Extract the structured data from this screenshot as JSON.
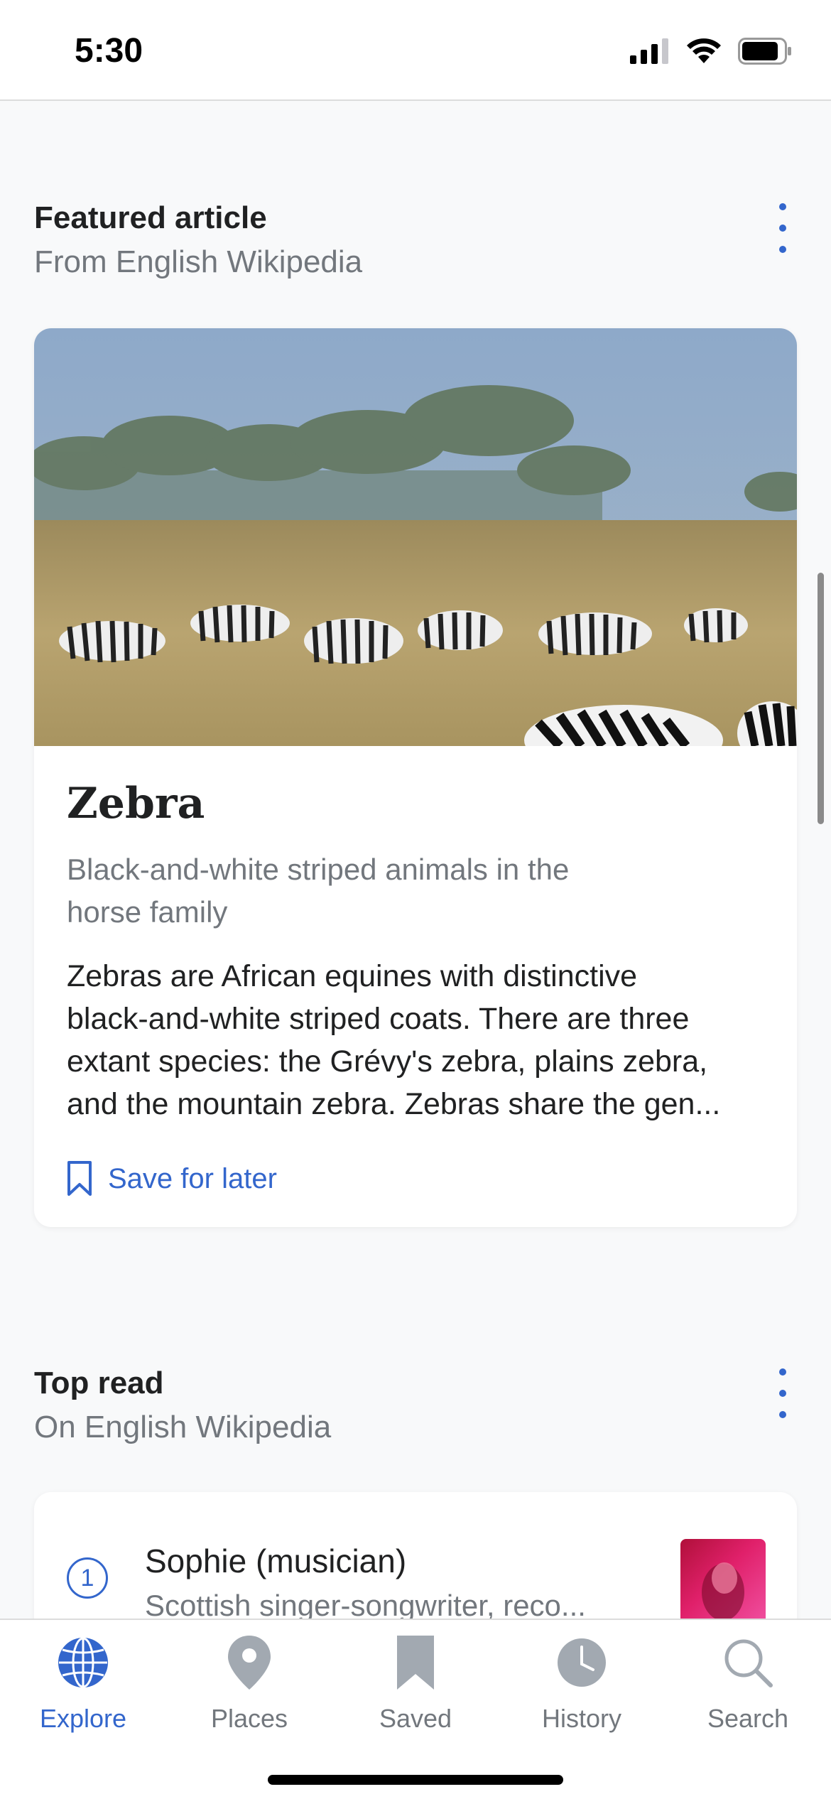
{
  "status_bar": {
    "time": "5:30"
  },
  "featured": {
    "title": "Featured article",
    "subtitle": "From English Wikipedia",
    "article": {
      "title": "Zebra",
      "description_line1": "Black-and-white striped animals in the",
      "description_line2": "horse family",
      "extract_lines": [
        "Zebras are African equines with distinctive",
        "black-and-white striped coats. There are three",
        "extant species: the Grévy's zebra, plains zebra,",
        "and the mountain zebra. Zebras share the gen..."
      ],
      "save_label": "Save for later"
    }
  },
  "top_read": {
    "title": "Top read",
    "subtitle": "On English Wikipedia",
    "items": [
      {
        "rank": "1",
        "title": "Sophie (musician)",
        "description": "Scottish singer-songwriter, reco..."
      }
    ]
  },
  "tabs": [
    {
      "label": "Explore",
      "icon": "globe-icon",
      "active": true
    },
    {
      "label": "Places",
      "icon": "map-pin-icon",
      "active": false
    },
    {
      "label": "Saved",
      "icon": "bookmark-icon",
      "active": false
    },
    {
      "label": "History",
      "icon": "clock-icon",
      "active": false
    },
    {
      "label": "Search",
      "icon": "search-icon",
      "active": false
    }
  ],
  "colors": {
    "accent": "#3366cc",
    "text_primary": "#202122",
    "text_secondary": "#72777d",
    "tab_inactive_icon": "#a2a9b1",
    "background": "#f8f9fa"
  }
}
